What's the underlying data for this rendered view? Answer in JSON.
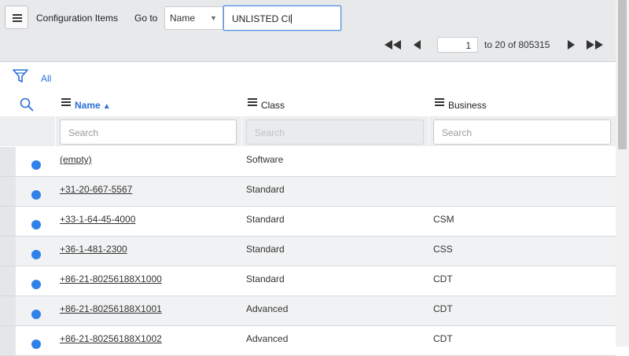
{
  "header": {
    "title": "Configuration Items",
    "goto_label": "Go to",
    "field_select": "Name",
    "goto_value": "UNLISTED CI"
  },
  "pager": {
    "current_page": "1",
    "range_text": "to 20 of 805315"
  },
  "filter": {
    "label": "All"
  },
  "columns": [
    {
      "label": "Name",
      "sorted": "ascending"
    },
    {
      "label": "Class"
    },
    {
      "label": "Business"
    }
  ],
  "search": {
    "name_placeholder": "Search",
    "class_placeholder": "Search",
    "business_placeholder": "Search"
  },
  "rows": [
    {
      "name": "(empty)",
      "class": "Software",
      "business": ""
    },
    {
      "name": "+31-20-667-5567",
      "class": "Standard",
      "business": ""
    },
    {
      "name": "+33-1-64-45-4000",
      "class": "Standard",
      "business": "CSM"
    },
    {
      "name": "+36-1-481-2300",
      "class": "Standard",
      "business": "CSS"
    },
    {
      "name": "+86-21-80256188X1000",
      "class": "Standard",
      "business": "CDT"
    },
    {
      "name": "+86-21-80256188X1001",
      "class": "Advanced",
      "business": "CDT"
    },
    {
      "name": "+86-21-80256188X1002",
      "class": "Advanced",
      "business": "CDT"
    }
  ],
  "colors": {
    "accent": "#2a6fd6",
    "status_dot": "#2f82e8",
    "header_bg": "#e7e9eb"
  }
}
